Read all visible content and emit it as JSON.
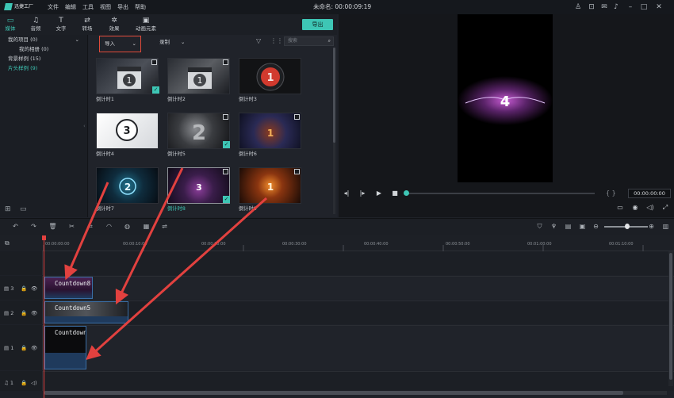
{
  "app": {
    "logo_text": "迅捷工厂"
  },
  "menu": [
    "文件",
    "编辑",
    "工具",
    "视图",
    "导出",
    "帮助"
  ],
  "document_title": "未命名: 00:00:09:19",
  "media_tabs": [
    {
      "label": "媒体",
      "icon": "folder-icon",
      "glyph": "🗀"
    },
    {
      "label": "音频",
      "icon": "music-note-icon",
      "glyph": "♫"
    },
    {
      "label": "文字",
      "icon": "text-icon",
      "glyph": "T"
    },
    {
      "label": "转场",
      "icon": "transition-icon",
      "glyph": "⇄"
    },
    {
      "label": "效果",
      "icon": "effects-icon",
      "glyph": "✲"
    },
    {
      "label": "动画元素",
      "icon": "image-icon",
      "glyph": "▣"
    }
  ],
  "export_label": "导出",
  "tree": [
    {
      "label": "我的项目 (0)"
    },
    {
      "label": "我的相册 (0)"
    },
    {
      "label": "背景样例 (15)"
    },
    {
      "label": "片头样例 (9)"
    }
  ],
  "toolbar": {
    "import_label": "导入",
    "record_label": "录制",
    "search_placeholder": "搜索"
  },
  "tiles": [
    {
      "label": "倒计时1",
      "num": "1",
      "selected": false,
      "checked": true,
      "film": true
    },
    {
      "label": "倒计时2",
      "num": "1",
      "selected": false,
      "checked": false,
      "film": true
    },
    {
      "label": "倒计时3",
      "num": "1",
      "selected": false,
      "checked": false,
      "film": false
    },
    {
      "label": "倒计时4",
      "num": "3",
      "selected": false,
      "checked": false,
      "film": false
    },
    {
      "label": "倒计时5",
      "num": "2",
      "selected": false,
      "checked": true,
      "film": true
    },
    {
      "label": "倒计时6",
      "num": "1",
      "selected": false,
      "checked": false,
      "film": true
    },
    {
      "label": "倒计时7",
      "num": "2",
      "selected": false,
      "checked": false,
      "film": false
    },
    {
      "label": "倒计时8",
      "num": "3",
      "selected": true,
      "checked": true,
      "film": true
    },
    {
      "label": "倒计时9",
      "num": "1",
      "selected": false,
      "checked": false,
      "film": true
    }
  ],
  "preview": {
    "frame_number": "4",
    "timecode": "00:00:00:00",
    "brackets": "{ }"
  },
  "ruler_ticks": [
    "00:00:00:00",
    "00:00:10:00",
    "00:00:20:00",
    "00:00:30:00",
    "00:00:40:00",
    "00:00:50:00",
    "00:01:00:00",
    "00:01:10:00"
  ],
  "tracks": [
    {
      "label": "3",
      "clip": "Countdown8"
    },
    {
      "label": "2",
      "clip": "Countdown5"
    },
    {
      "label": "1",
      "clip": "Countdown"
    },
    {
      "label": "1",
      "clip": ""
    }
  ],
  "colors": {
    "accent": "#3ec6b5",
    "import_border": "#e04b3a",
    "arrow": "#e2413f",
    "playhead": "#e2413f"
  }
}
